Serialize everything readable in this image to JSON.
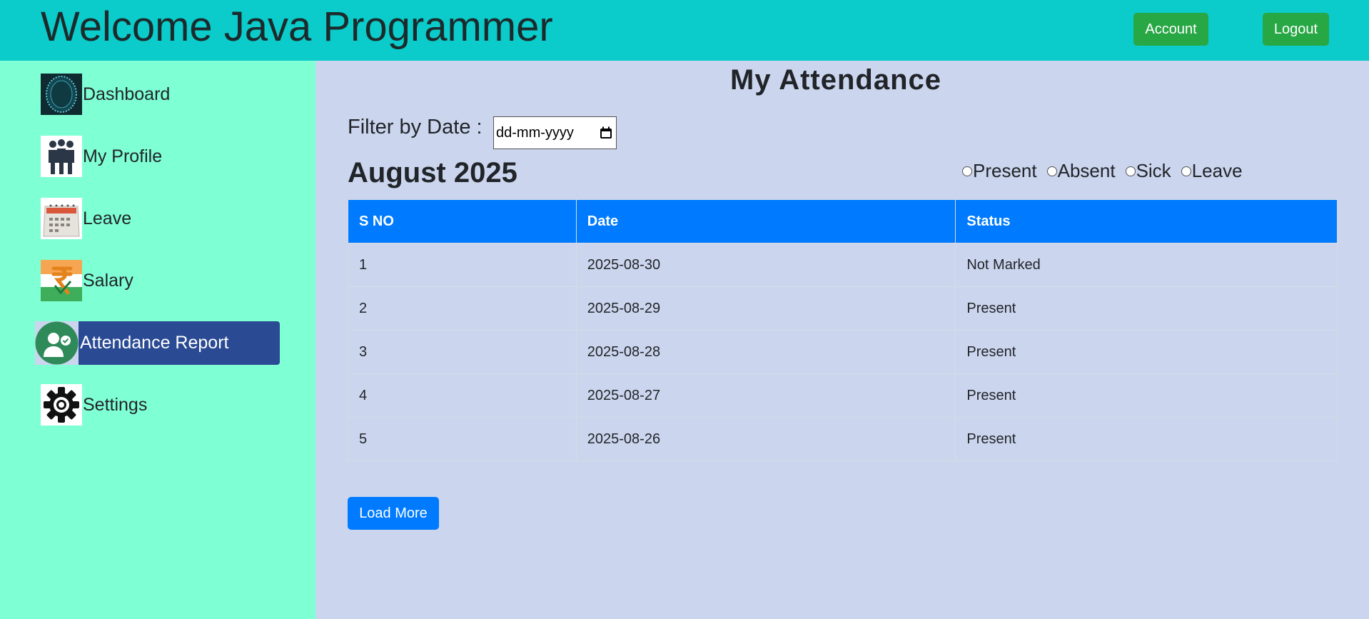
{
  "header": {
    "welcome": "Welcome Java Programmer",
    "account_label": "Account",
    "logout_label": "Logout"
  },
  "sidebar": {
    "items": [
      {
        "label": "Dashboard",
        "icon": "dashboard-icon"
      },
      {
        "label": "My Profile",
        "icon": "people-icon"
      },
      {
        "label": "Leave",
        "icon": "calendar-icon"
      },
      {
        "label": "Salary",
        "icon": "rupee-icon"
      },
      {
        "label": "Attendance Report",
        "icon": "attendance-icon",
        "active": true
      },
      {
        "label": "Settings",
        "icon": "gear-icon"
      }
    ]
  },
  "main": {
    "title": "My Attendance",
    "filter_label": "Filter by Date :",
    "date_placeholder": "dd-mm-yyyy",
    "month": "August 2025",
    "legend": [
      "Present",
      "Absent",
      "Sick",
      "Leave"
    ],
    "table": {
      "headers": [
        "S NO",
        "Date",
        "Status"
      ],
      "rows": [
        [
          "1",
          "2025-08-30",
          "Not Marked"
        ],
        [
          "2",
          "2025-08-29",
          "Present"
        ],
        [
          "3",
          "2025-08-28",
          "Present"
        ],
        [
          "4",
          "2025-08-27",
          "Present"
        ],
        [
          "5",
          "2025-08-26",
          "Present"
        ]
      ]
    },
    "load_more_label": "Load More"
  },
  "colors": {
    "topbar": "#0bcbcb",
    "sidebar": "#7fffd4",
    "content_bg": "#cbd5ee",
    "active_item": "#2a4a93",
    "table_header": "#007bff",
    "green_button": "#28a745"
  }
}
